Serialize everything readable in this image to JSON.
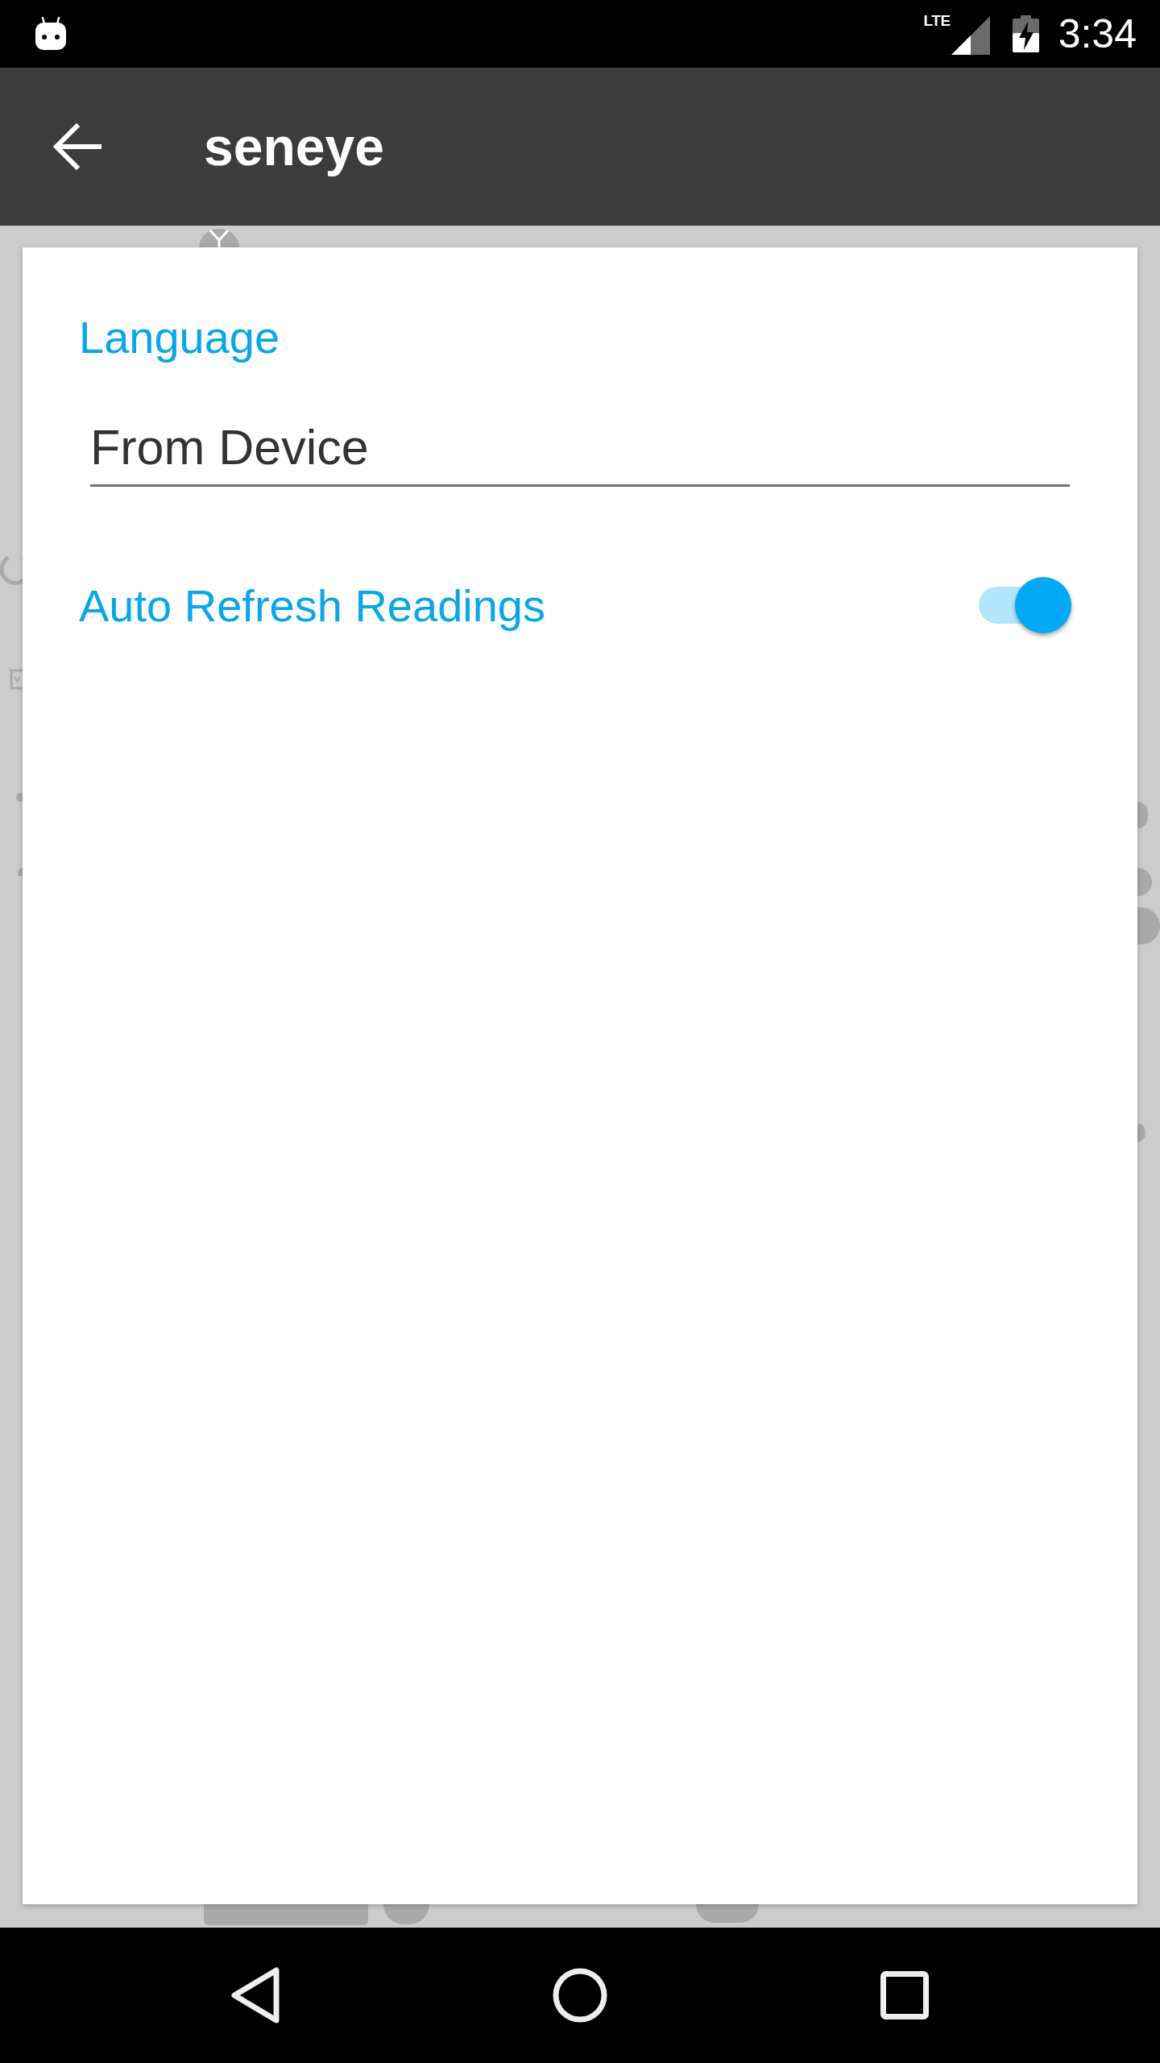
{
  "status_bar": {
    "network_type": "LTE",
    "time": "3:34"
  },
  "app_bar": {
    "title": "seneye"
  },
  "dialog": {
    "language": {
      "label": "Language",
      "value": "From Device"
    },
    "auto_refresh": {
      "label": "Auto Refresh Readings",
      "on": true
    }
  }
}
